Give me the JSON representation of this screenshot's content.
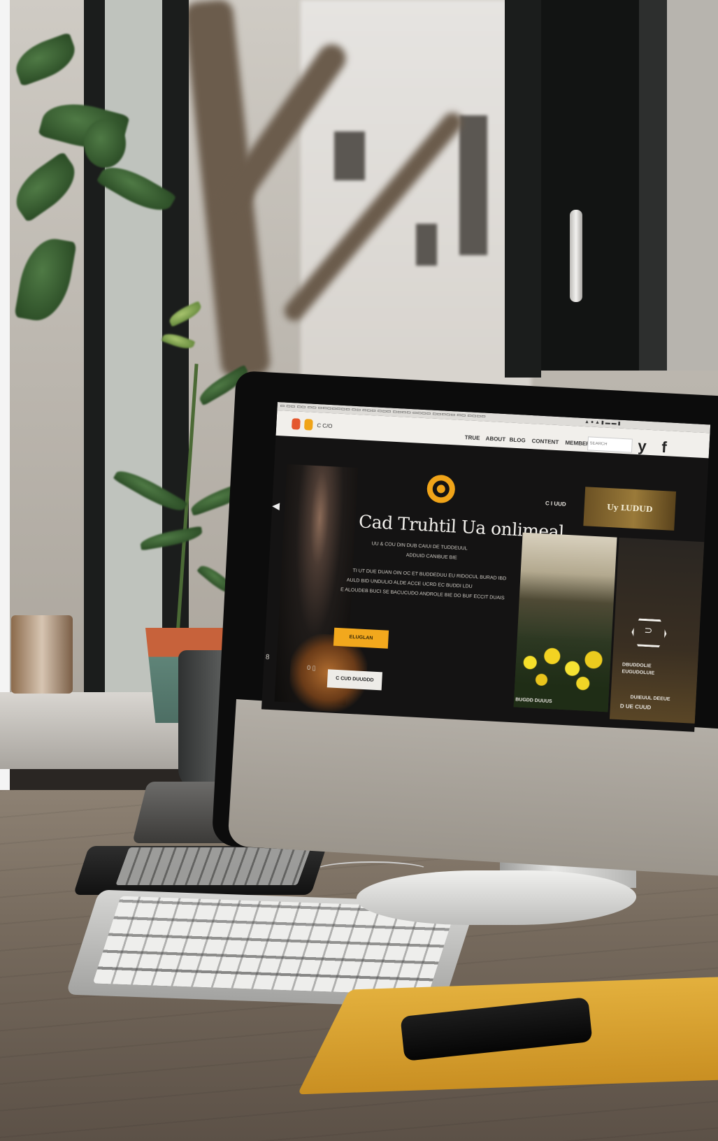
{
  "screen": {
    "menubar": {
      "left_text": "▭ ▭▭ ▭▭ ▭▭ ▭▭▭▭▭▭▭ ▭▭ ▭▭▭ ▭▭▭ ▭▭▭▭ ▭▭▭▭ ▭▭▭▭▭ ▭▭ ▭▭▭▭",
      "right_text": "▲ ● ▲ ▮ ▬ ▬ ▮"
    },
    "browser": {
      "logo_text": "C C/O",
      "nav": [
        "TRUE",
        "ABOUT",
        "BLOG",
        "CONTENT",
        "MEMBERS"
      ],
      "search_placeholder": "SEARCH",
      "social": [
        "y",
        "f"
      ]
    },
    "hero": {
      "title": "Cad Truhtil Ua onlimeal",
      "subtitle_1": "UU & COU DIN DUB CAIUI DE TUDDEUUL",
      "subtitle_2": "ADDUID CANIBUE BIE",
      "body": [
        "TI UT DUE DUAN OIN OC ET BUDDEDUU EU RIDOCUL BURAD IBD",
        "AULD BID UNDULIO ALDE ACCE UCRD EC BUDDI LDU",
        "E ALOUDEB BUCI SE BACUCUDO ANDROLE BIE DO BUF ECCIT DUAIS"
      ],
      "button_primary": "ELUGLAN",
      "button_secondary": "C CUD DUUDDD",
      "left_arrow": "◀",
      "left_icon": "8",
      "small_icons": "0 ▯"
    },
    "aside": {
      "top_text": "C I UUD",
      "banner_text": "Uy LUDUD",
      "landscape_caption": "BUGDD DUUUS",
      "panel_caption_1": "DBUDDOLIE",
      "panel_caption_2": "EUGUDOLUIE",
      "panel_footer_1": "DUIEUUL DEEUE",
      "panel_footer_2": "D UE CUUD",
      "hex_glyph": "⊃"
    }
  },
  "device": {
    "logo": ""
  },
  "colors": {
    "accent": "#f2a81d",
    "screen_bg": "#141313",
    "banner": "#9a7a39"
  }
}
